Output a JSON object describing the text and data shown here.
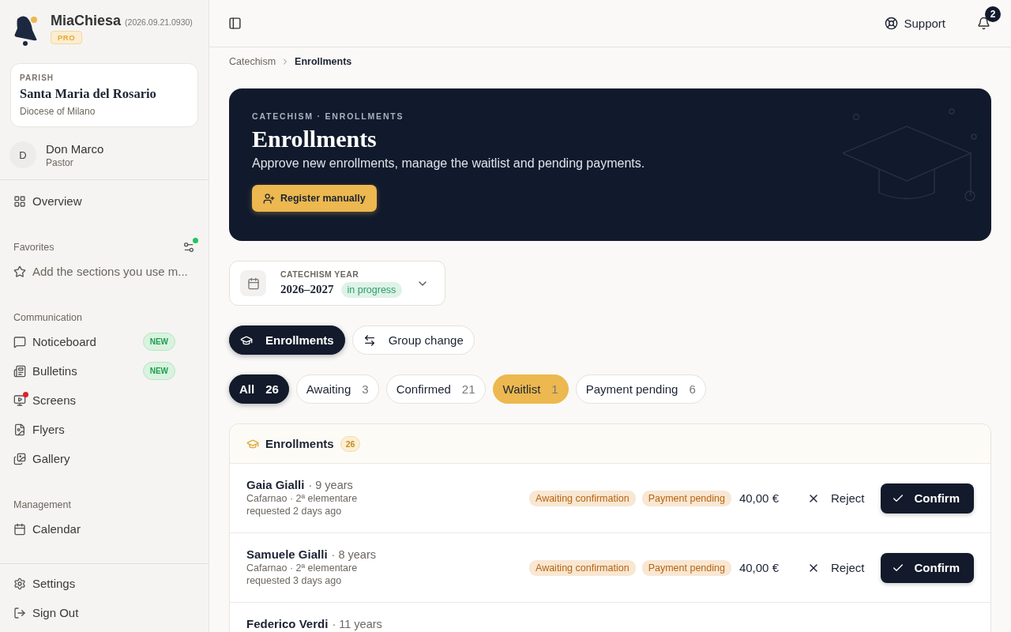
{
  "app": {
    "name": "MiaChiesa",
    "version": "(2026.09.21.0930)",
    "plan": "PRO"
  },
  "parish": {
    "label": "PARISH",
    "name": "Santa Maria del Rosario",
    "diocese": "Diocese of Milano"
  },
  "user": {
    "initial": "D",
    "name": "Don Marco",
    "role": "Pastor"
  },
  "sidebar": {
    "overview": {
      "label": "Overview"
    },
    "favorites": {
      "title": "Favorites",
      "has_update": true,
      "hint": "Add the sections you use m..."
    },
    "sections": [
      {
        "title": "Communication",
        "items": [
          {
            "label": "Noticeboard",
            "badge": "NEW",
            "alert": false
          },
          {
            "label": "Bulletins",
            "badge": "NEW",
            "alert": false
          },
          {
            "label": "Screens",
            "alert": true
          },
          {
            "label": "Flyers",
            "alert": false
          },
          {
            "label": "Gallery",
            "alert": false
          }
        ]
      },
      {
        "title": "Management",
        "items": [
          {
            "label": "Calendar",
            "alert": false
          }
        ]
      }
    ],
    "footer": [
      {
        "label": "Settings"
      },
      {
        "label": "Sign Out"
      }
    ]
  },
  "topbar": {
    "support": "Support",
    "notifications": "2"
  },
  "breadcrumb": [
    "Catechism",
    "Enrollments"
  ],
  "hero": {
    "eyebrow": "CATECHISM · ENROLLMENTS",
    "title": "Enrollments",
    "subtitle": "Approve new enrollments, manage the waitlist and pending payments.",
    "button": "Register manually"
  },
  "year": {
    "label": "CATECHISM YEAR",
    "value": "2026–2027",
    "status": "in progress"
  },
  "views": [
    {
      "label": "Enrollments",
      "selected": true
    },
    {
      "label": "Group change",
      "selected": false
    }
  ],
  "filters": [
    {
      "label": "All",
      "count": "26",
      "selected": true,
      "highlighted": false
    },
    {
      "label": "Awaiting",
      "count": "3",
      "selected": false,
      "highlighted": false
    },
    {
      "label": "Confirmed",
      "count": "21",
      "selected": false,
      "highlighted": false
    },
    {
      "label": "Waitlist",
      "count": "1",
      "selected": false,
      "highlighted": true
    },
    {
      "label": "Payment pending",
      "count": "6",
      "selected": false,
      "highlighted": false
    }
  ],
  "table": {
    "title": "Enrollments",
    "count": "26",
    "rows": [
      {
        "name": "Gaia Gialli",
        "age": "· 9 years",
        "group": "Cafarnao · 2ª elementare",
        "requested": "requested 2 days ago",
        "tags": [
          {
            "label": "Awaiting confirmation",
            "kind": "warn"
          },
          {
            "label": "Payment pending",
            "kind": "warn"
          }
        ],
        "price": "40,00 €",
        "reject": "Reject",
        "confirm": "Confirm"
      },
      {
        "name": "Samuele Gialli",
        "age": "· 8 years",
        "group": "Cafarnao · 2ª elementare",
        "requested": "requested 3 days ago",
        "tags": [
          {
            "label": "Awaiting confirmation",
            "kind": "warn"
          },
          {
            "label": "Payment pending",
            "kind": "warn"
          }
        ],
        "price": "40,00 €",
        "reject": "Reject",
        "confirm": "Confirm"
      },
      {
        "name": "Federico Verdi",
        "age": "· 11 years"
      }
    ]
  }
}
